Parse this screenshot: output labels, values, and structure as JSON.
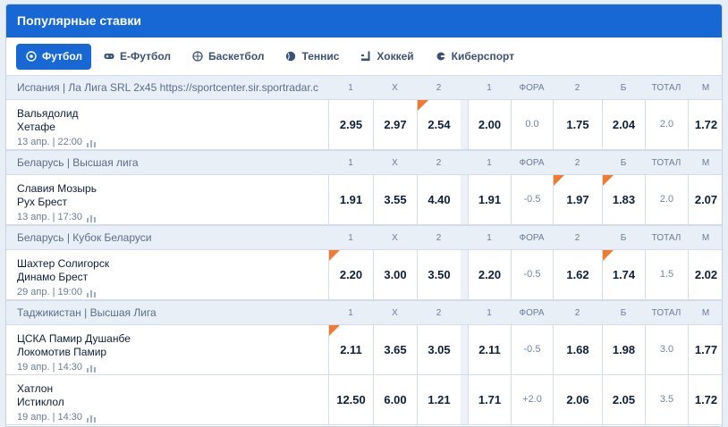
{
  "title": "Популярные ставки",
  "tabs": [
    {
      "label": "Футбол",
      "icon": "soccer-ball-icon",
      "active": true
    },
    {
      "label": "Е-Футбол",
      "icon": "gamepad-icon",
      "active": false
    },
    {
      "label": "Баскетбол",
      "icon": "basketball-icon",
      "active": false
    },
    {
      "label": "Теннис",
      "icon": "tennis-ball-icon",
      "active": false
    },
    {
      "label": "Хоккей",
      "icon": "hockey-stick-icon",
      "active": false
    },
    {
      "label": "Киберспорт",
      "icon": "esports-icon",
      "active": false
    }
  ],
  "columns": [
    "1",
    "X",
    "2",
    "1",
    "ФОРА",
    "2",
    "Б",
    "ТОТАЛ",
    "М"
  ],
  "leagues": [
    {
      "name": "Испания | Ла Лига SRL 2x45 https://sportcenter.sir.sportradar.c",
      "matches": [
        {
          "team1": "Вальядолид",
          "team2": "Хетафе",
          "date": "13 апр. | 22:00",
          "odds": [
            "2.95",
            "2.97",
            "2.54",
            "2.00",
            "0.0",
            "1.75",
            "2.04",
            "2.0",
            "1.72"
          ],
          "flags": [
            false,
            false,
            true,
            false,
            false,
            false,
            false,
            false,
            false
          ]
        }
      ]
    },
    {
      "name": "Беларусь | Высшая лига",
      "matches": [
        {
          "team1": "Славия Мозырь",
          "team2": "Рух Брест",
          "date": "13 апр. | 17:30",
          "odds": [
            "1.91",
            "3.55",
            "4.40",
            "1.91",
            "-0.5",
            "1.97",
            "1.83",
            "2.0",
            "2.07"
          ],
          "flags": [
            false,
            false,
            false,
            false,
            false,
            true,
            true,
            false,
            false
          ]
        }
      ]
    },
    {
      "name": "Беларусь | Кубок Беларуси",
      "matches": [
        {
          "team1": "Шахтер Солигорск",
          "team2": "Динамо Брест",
          "date": "29 апр. | 19:00",
          "odds": [
            "2.20",
            "3.00",
            "3.50",
            "2.20",
            "-0.5",
            "1.62",
            "1.74",
            "1.5",
            "2.02"
          ],
          "flags": [
            true,
            false,
            false,
            false,
            false,
            false,
            true,
            false,
            false
          ]
        }
      ]
    },
    {
      "name": "Таджикистан | Высшая Лига",
      "matches": [
        {
          "team1": "ЦСКА Памир Душанбе",
          "team2": "Локомотив Памир",
          "date": "19 апр. | 14:30",
          "odds": [
            "2.11",
            "3.65",
            "3.05",
            "2.11",
            "-0.5",
            "1.68",
            "1.98",
            "3.0",
            "1.77"
          ],
          "flags": [
            true,
            false,
            false,
            false,
            false,
            false,
            false,
            false,
            false
          ]
        },
        {
          "team1": "Хатлон",
          "team2": "Истиклол",
          "date": "19 апр. | 14:30",
          "odds": [
            "12.50",
            "6.00",
            "1.21",
            "1.71",
            "+2.0",
            "2.06",
            "2.05",
            "3.5",
            "1.72"
          ],
          "flags": [
            false,
            false,
            false,
            false,
            false,
            false,
            false,
            false,
            false
          ]
        }
      ]
    }
  ],
  "colors": {
    "accent": "#1767d4",
    "flag": "#f07a30",
    "header_row": "#e9eff7"
  }
}
